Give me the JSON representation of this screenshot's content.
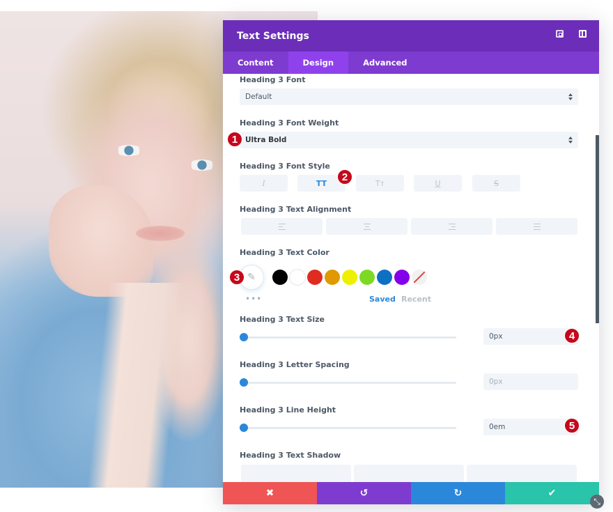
{
  "modal": {
    "title": "Text Settings",
    "header_icons": [
      "expand-icon",
      "split-view-icon"
    ],
    "tabs": [
      {
        "label": "Content",
        "active": false
      },
      {
        "label": "Design",
        "active": true
      },
      {
        "label": "Advanced",
        "active": false
      }
    ]
  },
  "fields": {
    "font": {
      "label": "Heading 3 Font",
      "value": "Default"
    },
    "font_weight": {
      "label": "Heading 3 Font Weight",
      "value": "Ultra Bold"
    },
    "font_style": {
      "label": "Heading 3 Font Style",
      "buttons": [
        {
          "name": "italic",
          "glyph": "I",
          "active": false
        },
        {
          "name": "uppercase",
          "glyph": "TT",
          "active": true
        },
        {
          "name": "small-caps",
          "glyph": "Tт",
          "active": false
        },
        {
          "name": "underline",
          "glyph": "U",
          "active": false
        },
        {
          "name": "strikethrough",
          "glyph": "S",
          "active": false
        }
      ]
    },
    "text_alignment": {
      "label": "Heading 3 Text Alignment",
      "options": [
        "left",
        "center",
        "right",
        "justify"
      ]
    },
    "text_color": {
      "label": "Heading 3 Text Color",
      "swatches": [
        "#000000",
        "#ffffff",
        "#e02b20",
        "#e09900",
        "#edf000",
        "#7cda24",
        "#0c71c3",
        "#8300e9"
      ],
      "more_label": "•••",
      "saved_label": "Saved",
      "recent_label": "Recent"
    },
    "text_size": {
      "label": "Heading 3 Text Size",
      "value": "0px",
      "slider_fraction": 0
    },
    "letter_spacing": {
      "label": "Heading 3 Letter Spacing",
      "value": "0px",
      "slider_fraction": 0
    },
    "line_height": {
      "label": "Heading 3 Line Height",
      "value": "0em",
      "slider_fraction": 0
    },
    "text_shadow": {
      "label": "Heading 3 Text Shadow"
    }
  },
  "annotations": [
    "1",
    "2",
    "3",
    "4",
    "5"
  ],
  "footer": {
    "cancel": {
      "glyph": "✖",
      "color": "#ef5555"
    },
    "undo": {
      "glyph": "↺",
      "color": "#7e3bd0"
    },
    "redo": {
      "glyph": "↻",
      "color": "#2b87da"
    },
    "save": {
      "glyph": "✔",
      "color": "#29c4a9"
    }
  },
  "resize_glyph": "⤡",
  "colors": {
    "header": "#6c2eb9",
    "tabs": "#7e3bd0",
    "active_tab": "#8f42ec",
    "accent": "#2b87da",
    "badge": "#c5081c"
  }
}
